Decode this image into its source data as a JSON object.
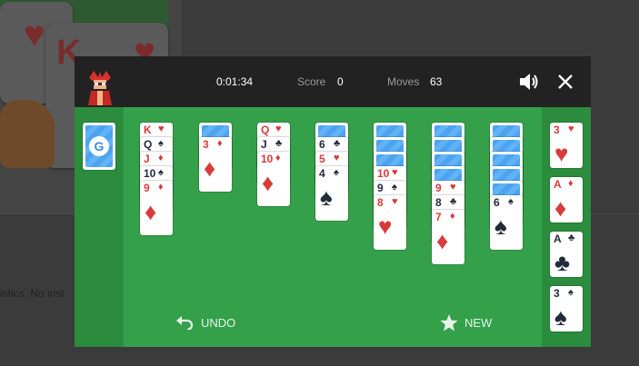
{
  "background": {
    "status_text": "istics. No inst"
  },
  "topbar": {
    "timer": "0:01:34",
    "score_label": "Score",
    "score_value": "0",
    "moves_label": "Moves",
    "moves_value": "63"
  },
  "stock": {
    "logo_letter": "G"
  },
  "tableau": [
    {
      "hidden": 0,
      "cards": [
        {
          "rank": "K",
          "suit": "♥",
          "color": "red"
        },
        {
          "rank": "Q",
          "suit": "♠",
          "color": "black"
        },
        {
          "rank": "J",
          "suit": "♦",
          "color": "red"
        },
        {
          "rank": "10",
          "suit": "♠",
          "color": "black"
        },
        {
          "rank": "9",
          "suit": "♦",
          "color": "red"
        }
      ]
    },
    {
      "hidden": 1,
      "cards": [
        {
          "rank": "3",
          "suit": "♦",
          "color": "red"
        }
      ]
    },
    {
      "hidden": 0,
      "cards": [
        {
          "rank": "Q",
          "suit": "♥",
          "color": "red"
        },
        {
          "rank": "J",
          "suit": "♣",
          "color": "black"
        },
        {
          "rank": "10",
          "suit": "♦",
          "color": "red"
        }
      ]
    },
    {
      "hidden": 1,
      "cards": [
        {
          "rank": "6",
          "suit": "♣",
          "color": "black"
        },
        {
          "rank": "5",
          "suit": "♥",
          "color": "red"
        },
        {
          "rank": "4",
          "suit": "♠",
          "color": "black"
        }
      ]
    },
    {
      "hidden": 3,
      "cards": [
        {
          "rank": "10",
          "suit": "♥",
          "color": "red"
        },
        {
          "rank": "9",
          "suit": "♠",
          "color": "black"
        },
        {
          "rank": "8",
          "suit": "♥",
          "color": "red"
        }
      ]
    },
    {
      "hidden": 4,
      "cards": [
        {
          "rank": "9",
          "suit": "♥",
          "color": "red"
        },
        {
          "rank": "8",
          "suit": "♣",
          "color": "black"
        },
        {
          "rank": "7",
          "suit": "♦",
          "color": "red"
        }
      ]
    },
    {
      "hidden": 5,
      "cards": [
        {
          "rank": "6",
          "suit": "♠",
          "color": "black"
        }
      ]
    }
  ],
  "foundations": [
    {
      "rank": "3",
      "suit": "♥",
      "color": "red"
    },
    {
      "rank": "A",
      "suit": "♦",
      "color": "red"
    },
    {
      "rank": "A",
      "suit": "♣",
      "color": "black"
    },
    {
      "rank": "3",
      "suit": "♠",
      "color": "black"
    }
  ],
  "actions": {
    "undo_label": "UNDO",
    "new_label": "NEW"
  },
  "colors": {
    "board": "#34a04a",
    "side": "#2b8c3e",
    "topbar": "#222222",
    "red_suit": "#d93a3a",
    "black_suit": "#222b3a"
  }
}
